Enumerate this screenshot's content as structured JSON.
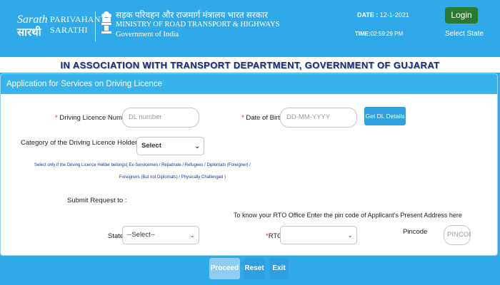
{
  "header": {
    "logo_text": "Sarathi",
    "brand_line1": "PARIVAHAN",
    "brand_line2": "SARATHI",
    "ministry_hindi": "सड़क परिवहन और राजमार्ग मंत्रालय भारत सरकार",
    "ministry_en": "MINISTRY OF ROAD TRANSPORT & HIGHWAYS",
    "gov": "Government of India",
    "date_label": "DATE :",
    "date_value": "12-1-2021",
    "time_label": "TIME:",
    "time_value": "02:59:29 PM",
    "login_label": "Login",
    "select_state_label": "Select State"
  },
  "banner": "IN ASSOCIATION WITH TRANSPORT DEPARTMENT, GOVERNMENT OF GUJARAT",
  "card": {
    "title": "Application for Services on Driving Licence",
    "dl_label": "Driving Licence Number",
    "dl_placeholder": "DL number",
    "dob_label": "Date of Birth",
    "dob_placeholder": "DD-MM-YYYY",
    "get_dl_label": "Get DL Details",
    "category_label": "Category of the Driving Licence Holder :",
    "category_value": "Select",
    "category_hint_line1": "Select only if the Driving Licence Holder belongs( Ex-Servicemen / Repatriate / Refugees / Diplomats (Foreigner) /",
    "category_hint_line2": "Foreigners (But not Diplomats) / Physically Challenged )",
    "submit_label": "Submit Request to :",
    "rto_info": "To know your RTO Office Enter the pin code of Applicant's Present Address here",
    "state_label": "State",
    "state_value": "--Select--",
    "rto_label": "RTO",
    "rto_value": "",
    "pincode_label": "Pincode",
    "pincode_placeholder": "PINCODE",
    "required_mark": "*"
  },
  "buttons": {
    "proceed": "Proceed",
    "reset": "Reset",
    "exit": "Exit"
  },
  "colors": {
    "page_bg": "#2fa9e8",
    "card_header": "#38b3ec",
    "login_green": "#2b7a32",
    "banner_text": "#1a2a80",
    "hint_text": "#1c2f9c",
    "required": "#e02020"
  }
}
